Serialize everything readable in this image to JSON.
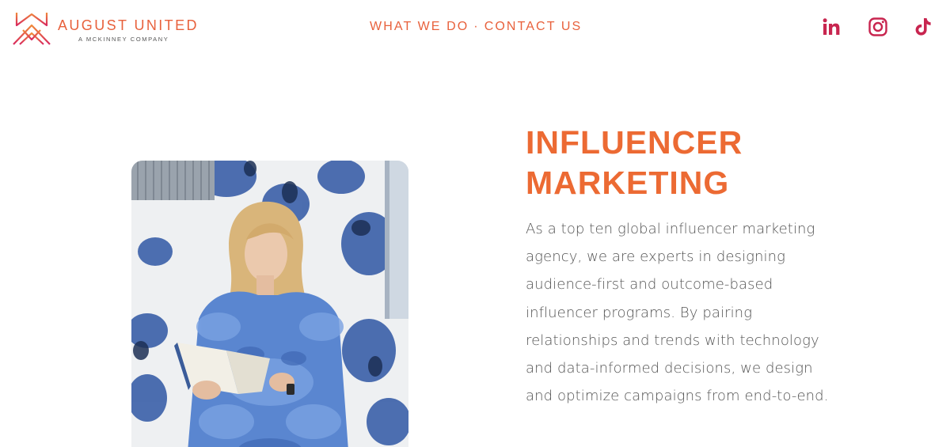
{
  "brand": {
    "name": "AUGUST UNITED",
    "tagline": "A MCKINNEY COMPANY"
  },
  "nav": {
    "items": [
      {
        "label": "WHAT WE DO"
      },
      {
        "label": "CONTACT US"
      }
    ],
    "separator": "·"
  },
  "social": [
    {
      "icon": "linkedin-icon",
      "label": "in"
    },
    {
      "icon": "instagram-icon"
    },
    {
      "icon": "tiktok-icon"
    }
  ],
  "hero": {
    "headline_line1": "INFLUENCER",
    "headline_line2": "MARKETING",
    "body": "As a top ten global influencer marketing agency, we are experts in designing audience-first and outcome-based influencer programs. By pairing relationships and trends with technology and data-informed decisions, we design and optimize campaigns from end-to-end."
  },
  "colors": {
    "accent": "#e8613c",
    "social": "#c8254f",
    "body_text": "#555555"
  }
}
